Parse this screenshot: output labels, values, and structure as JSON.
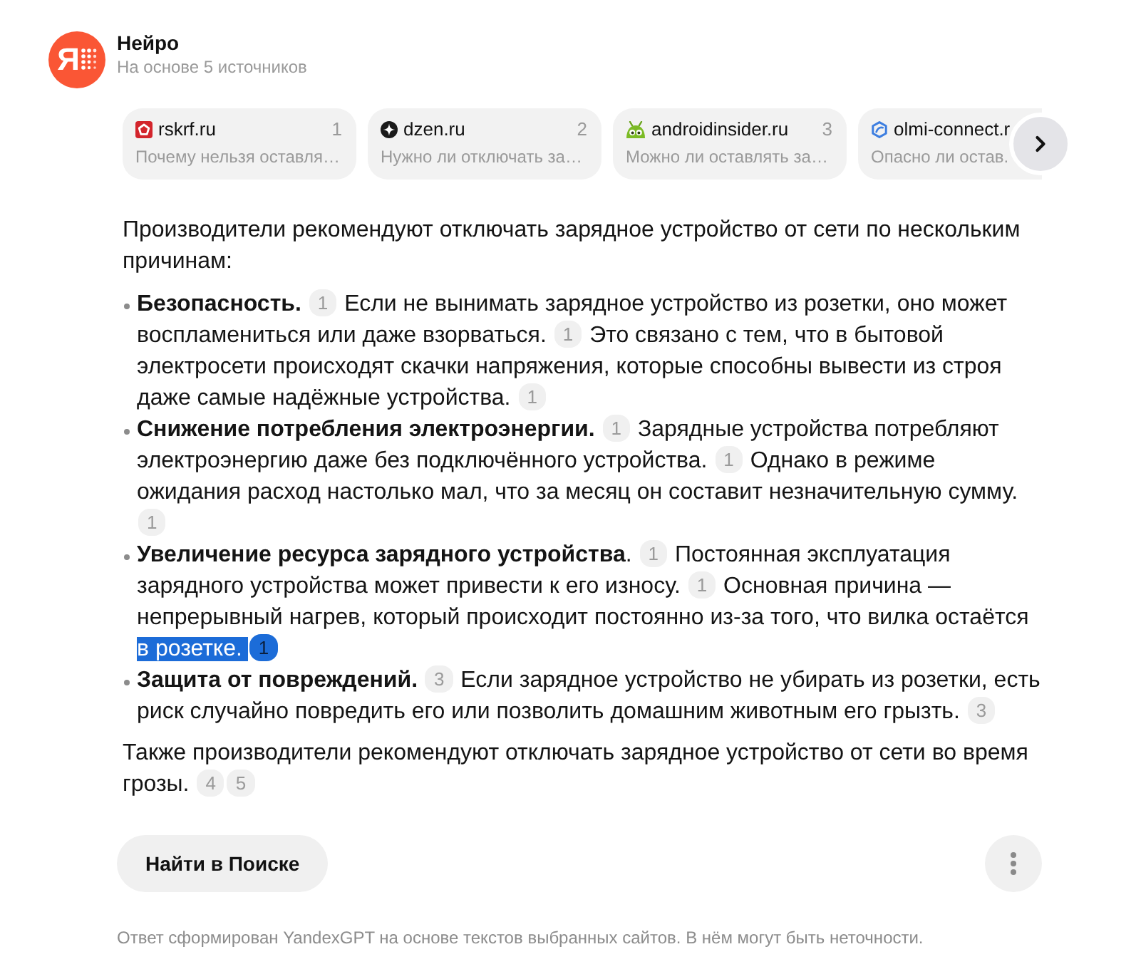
{
  "header": {
    "logo_letter": "Я",
    "title": "Нейро",
    "subtitle": "На основе 5 источников"
  },
  "sources": [
    {
      "kind": "pentagon",
      "domain": "rskrf.ru",
      "number": "1",
      "snippet": "Почему нельзя оставля…"
    },
    {
      "kind": "star",
      "domain": "dzen.ru",
      "number": "2",
      "snippet": "Нужно ли отключать за…"
    },
    {
      "kind": "robot",
      "domain": "androidinsider.ru",
      "number": "3",
      "snippet": "Можно ли оставлять за…"
    },
    {
      "kind": "ring",
      "domain": "olmi-connect.r",
      "snippet": "Опасно ли остав."
    }
  ],
  "answer": {
    "intro": [
      {
        "kind": "text",
        "text": "Производители рекомендуют отключать зарядное устройство от сети по нескольким причинам:",
        "selected": false
      }
    ],
    "points": [
      {
        "segments": [
          {
            "kind": "text",
            "text": "**Безопасность.**",
            "selected": false
          },
          {
            "kind": "cite",
            "text": "1",
            "selected": false
          },
          {
            "kind": "text",
            "text": "Если не вынимать зарядное устройство из розетки, оно может воспламениться или даже взорваться.",
            "selected": false
          },
          {
            "kind": "cite",
            "text": "1",
            "selected": false
          },
          {
            "kind": "text",
            "text": "Это связано с тем, что в бытовой электросети происходят скачки напряжения, которые способны вывести из строя даже самые надёжные устройства.",
            "selected": false
          },
          {
            "kind": "cite",
            "text": "1",
            "selected": false
          }
        ]
      },
      {
        "segments": [
          {
            "kind": "text",
            "text": "**Снижение потребления электроэнергии.**",
            "selected": false
          },
          {
            "kind": "cite",
            "text": "1",
            "selected": false
          },
          {
            "kind": "text",
            "text": "Зарядные устройства потребляют электроэнергию даже без подключённого устройства.",
            "selected": false
          },
          {
            "kind": "cite",
            "text": "1",
            "selected": false
          },
          {
            "kind": "text",
            "text": "Однако в режиме ожидания расход настолько мал, что за месяц он составит незначительную сумму.",
            "selected": false
          },
          {
            "kind": "cite",
            "text": "1",
            "selected": false
          }
        ]
      },
      {
        "segments": [
          {
            "kind": "text",
            "text": "**Увеличение ресурса зарядного устройства**.",
            "selected": false
          },
          {
            "kind": "cite",
            "text": "1",
            "selected": false
          },
          {
            "kind": "text",
            "text": "Постоянная эксплуатация зарядного устройства может привести к его износу.",
            "selected": false
          },
          {
            "kind": "cite",
            "text": "1",
            "selected": false
          },
          {
            "kind": "text",
            "text": "Основная причина — непрерывный нагрев, который происходит постоянно из-за того, что вилка остаётся",
            "selected": false
          },
          {
            "kind": "text",
            "text": "в розетке.",
            "selected": true
          },
          {
            "kind": "cite",
            "text": "1",
            "selected": true
          }
        ]
      },
      {
        "segments": [
          {
            "kind": "text",
            "text": "**Защита от повреждений.**",
            "selected": false
          },
          {
            "kind": "cite",
            "text": "3",
            "selected": false
          },
          {
            "kind": "text",
            "text": "Если зарядное устройство не убирать из розетки, есть риск случайно повредить его или позволить домашним животным его грызть.",
            "selected": false
          },
          {
            "kind": "cite",
            "text": "3",
            "selected": false
          }
        ]
      }
    ],
    "outro": [
      {
        "kind": "text",
        "text": "Также производители рекомендуют отключать зарядное устройство от сети во время грозы.",
        "selected": false
      },
      {
        "kind": "cite",
        "text": "4",
        "selected": false
      },
      {
        "kind": "cite",
        "text": "5",
        "selected": false
      }
    ]
  },
  "actions": {
    "search_button": "Найти в Поиске"
  },
  "disclaimer": "Ответ сформирован YandexGPT на основе текстов выбранных сайтов. В нём могут быть неточности."
}
